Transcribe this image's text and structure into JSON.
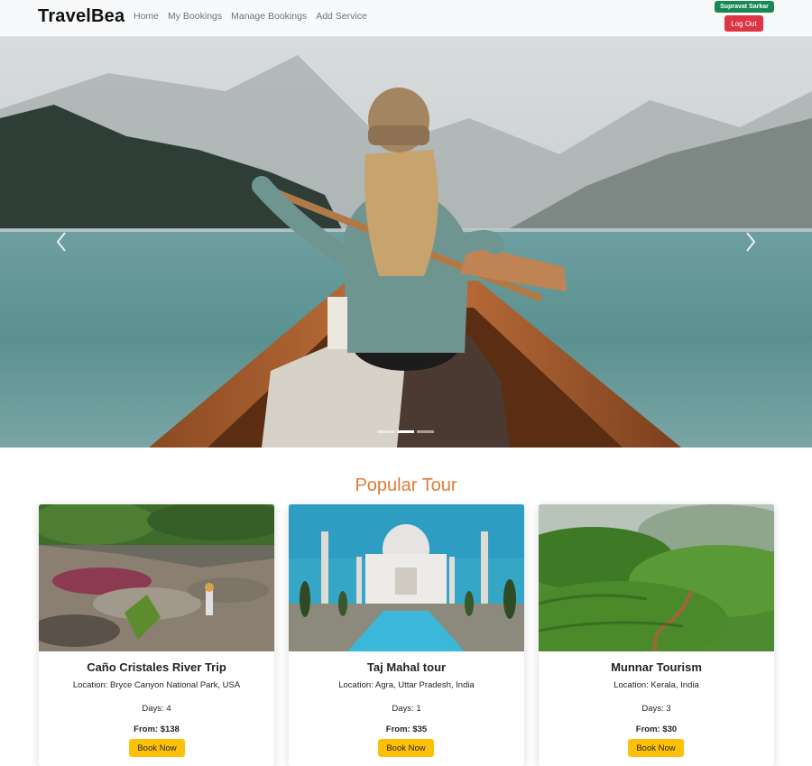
{
  "navbar": {
    "brand": "TravelBea",
    "links": [
      {
        "label": "Home"
      },
      {
        "label": "My Bookings"
      },
      {
        "label": "Manage Bookings"
      },
      {
        "label": "Add Service"
      }
    ],
    "user_name": "Supravat Sarkar",
    "logout_label": "Log Out"
  },
  "hero": {
    "prev_icon": "chevron-left-icon",
    "next_icon": "chevron-right-icon",
    "slide_count": 3,
    "active_slide": 2
  },
  "section": {
    "title": "Popular Tour"
  },
  "tours": [
    {
      "title": "Caño Cristales River Trip",
      "location": "Location: Bryce Canyon National Park, USA",
      "days": "Days: 4",
      "price": "From: $138",
      "button": "Book Now"
    },
    {
      "title": "Taj Mahal tour",
      "location": "Location: Agra, Uttar Pradesh, India",
      "days": "Days: 1",
      "price": "From: $35",
      "button": "Book Now"
    },
    {
      "title": "Munnar Tourism",
      "location": "Location: Kerala, India",
      "days": "Days: 3",
      "price": "From: $30",
      "button": "Book Now"
    }
  ],
  "colors": {
    "brand_accent": "#e07b39",
    "badge_green": "#198754",
    "logout_red": "#dc3545",
    "book_yellow": "#ffc107"
  }
}
